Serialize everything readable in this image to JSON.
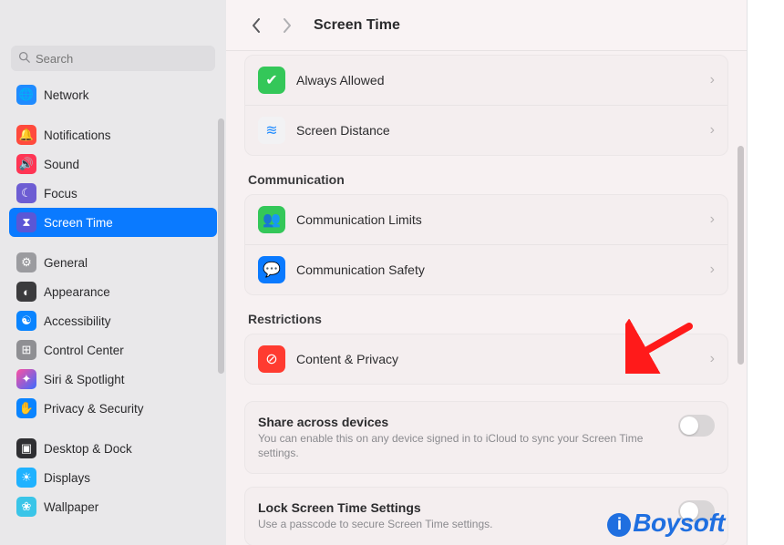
{
  "header": {
    "title": "Screen Time"
  },
  "search": {
    "placeholder": "Search"
  },
  "sidebar": {
    "items": [
      {
        "label": "Network",
        "color": "#1f8bff",
        "glyph": "🌐"
      },
      {
        "label": "Notifications",
        "color": "#ff4a3d",
        "glyph": "🔔"
      },
      {
        "label": "Sound",
        "color": "#ff3554",
        "glyph": "🔊"
      },
      {
        "label": "Focus",
        "color": "#6d5dd3",
        "glyph": "☾"
      },
      {
        "label": "Screen Time",
        "color": "#5b57d6",
        "glyph": "⧗",
        "selected": true
      },
      {
        "label": "General",
        "color": "#9b9b9f",
        "glyph": "⚙"
      },
      {
        "label": "Appearance",
        "color": "#3b3b3d",
        "glyph": "◐"
      },
      {
        "label": "Accessibility",
        "color": "#0a84ff",
        "glyph": "☯"
      },
      {
        "label": "Control Center",
        "color": "#8f8f93",
        "glyph": "⊞"
      },
      {
        "label": "Siri & Spotlight",
        "color": "#2f2f32",
        "glyph": "✦"
      },
      {
        "label": "Privacy & Security",
        "color": "#0a84ff",
        "glyph": "✋"
      },
      {
        "label": "Desktop & Dock",
        "color": "#2f2f32",
        "glyph": "▣"
      },
      {
        "label": "Displays",
        "color": "#1fb2ff",
        "glyph": "☀"
      },
      {
        "label": "Wallpaper",
        "color": "#3ac5e8",
        "glyph": "❀"
      }
    ]
  },
  "groups": {
    "top": [
      {
        "label": "Always Allowed",
        "color": "#34c759",
        "glyph": "✔"
      },
      {
        "label": "Screen Distance",
        "color": "#f2f2f4",
        "glyph": "≋",
        "fg": "#1f8bff"
      }
    ],
    "communication": {
      "title": "Communication",
      "items": [
        {
          "label": "Communication Limits",
          "color": "#34c759",
          "glyph": "👥"
        },
        {
          "label": "Communication Safety",
          "color": "#0a7aff",
          "glyph": "💬"
        }
      ]
    },
    "restrictions": {
      "title": "Restrictions",
      "items": [
        {
          "label": "Content & Privacy",
          "color": "#ff3b30",
          "glyph": "⊘"
        }
      ]
    }
  },
  "settings": {
    "share": {
      "title": "Share across devices",
      "desc": "You can enable this on any device signed in to iCloud to sync your Screen Time settings."
    },
    "lock": {
      "title": "Lock Screen Time Settings",
      "desc": "Use a passcode to secure Screen Time settings."
    }
  },
  "watermark": "Boysoft"
}
